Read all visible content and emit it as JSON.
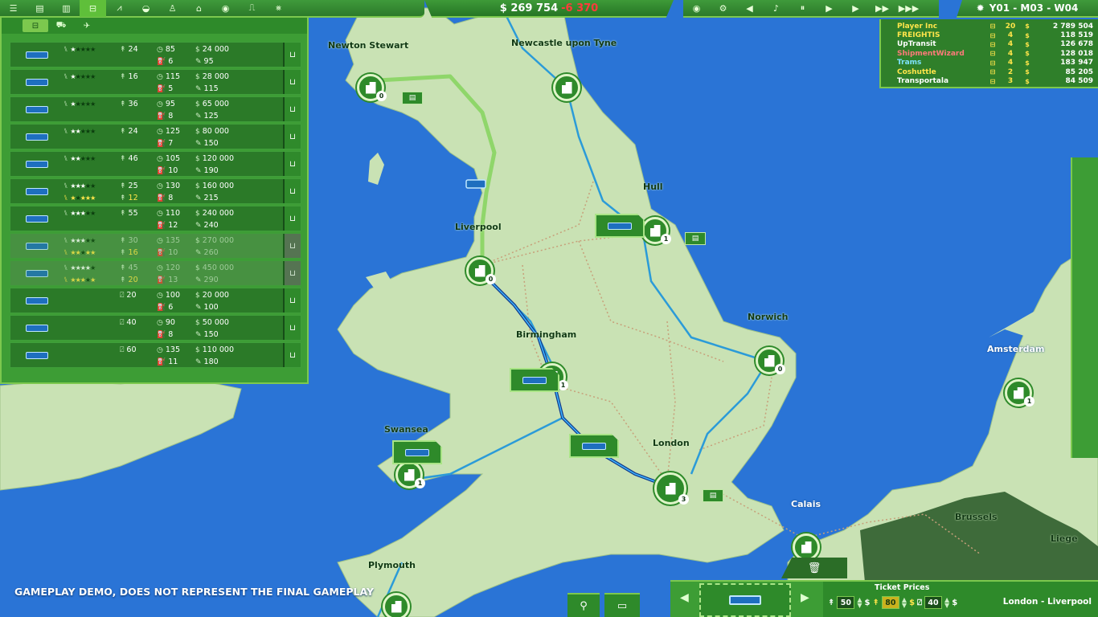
{
  "toolbar": {
    "left_icons": [
      "menu-icon",
      "finance-icon",
      "bank-icon",
      "bus-icon",
      "chart-icon",
      "helmet-icon",
      "person-icon",
      "building-icon",
      "gear-icon",
      "stats-icon",
      "graph-icon"
    ],
    "left_glyphs": [
      "☰",
      "▤",
      "▥",
      "⊟",
      "⩘",
      "◒",
      "♙",
      "⌂",
      "◉",
      "⎍",
      "⨳"
    ],
    "money": "$ 269 754",
    "money_delta": "-6 370",
    "media_glyphs": [
      "◉",
      "⚙",
      "◀",
      "♪",
      "⏸",
      "▶",
      "▶",
      "▶▶",
      "▶▶▶"
    ],
    "media_icons": [
      "eye-icon",
      "settings-icon",
      "volume-icon",
      "music-icon",
      "pause-icon",
      "play-icon",
      "speed1-icon",
      "speed2-icon",
      "speed3-icon"
    ],
    "date": "Y01 - M03 - W04"
  },
  "companies": [
    {
      "name": "Player Inc",
      "color": "#ffe54a",
      "count": "20",
      "value": "2 789 504"
    },
    {
      "name": "FREIGHTIS",
      "color": "#ffe54a",
      "count": "4",
      "value": "118 519"
    },
    {
      "name": "UpTransit",
      "color": "#ffffff",
      "count": "4",
      "value": "126 678"
    },
    {
      "name": "ShipmentWizard",
      "color": "#ff7a7a",
      "count": "4",
      "value": "128 018"
    },
    {
      "name": "Trams",
      "color": "#7fe3ff",
      "count": "4",
      "value": "183 947"
    },
    {
      "name": "Coshuttle",
      "color": "#ffe54a",
      "count": "2",
      "value": "85 205"
    },
    {
      "name": "Transportala",
      "color": "#ffffff",
      "count": "3",
      "value": "84 509"
    }
  ],
  "vehicle_tabs": [
    {
      "icon": "bus-icon",
      "glyph": "⊟",
      "active": true
    },
    {
      "icon": "truck-icon",
      "glyph": "⛟",
      "active": false
    },
    {
      "icon": "plane-icon",
      "glyph": "✈",
      "active": false
    }
  ],
  "vehicles": [
    {
      "stars": 1,
      "cap": "24",
      "speed": "85",
      "price": "24 000",
      "fuel": "6",
      "maint": "95",
      "type": "pax",
      "locked": false
    },
    {
      "stars": 1,
      "cap": "16",
      "speed": "115",
      "price": "28 000",
      "fuel": "5",
      "maint": "115",
      "type": "pax",
      "locked": false
    },
    {
      "stars": 1,
      "cap": "36",
      "speed": "95",
      "price": "65 000",
      "fuel": "8",
      "maint": "125",
      "type": "pax",
      "locked": false
    },
    {
      "stars": 2,
      "cap": "24",
      "speed": "125",
      "price": "80 000",
      "fuel": "7",
      "maint": "150",
      "type": "pax",
      "locked": false
    },
    {
      "stars": 2,
      "cap": "46",
      "speed": "105",
      "price": "120 000",
      "fuel": "10",
      "maint": "190",
      "type": "pax",
      "locked": false
    },
    {
      "stars": 3,
      "cap": "25",
      "speed": "130",
      "price": "160 000",
      "fuel": "8",
      "maint": "215",
      "type": "pax",
      "locked": false,
      "stars2": 1,
      "cap2": "12"
    },
    {
      "stars": 3,
      "cap": "55",
      "speed": "110",
      "price": "240 000",
      "fuel": "12",
      "maint": "240",
      "type": "pax",
      "locked": false
    },
    {
      "stars": 3,
      "cap": "30",
      "speed": "135",
      "price": "270 000",
      "fuel": "10",
      "maint": "260",
      "type": "pax",
      "locked": true,
      "stars2": 2,
      "cap2": "16"
    },
    {
      "stars": 4,
      "cap": "45",
      "speed": "120",
      "price": "450 000",
      "fuel": "13",
      "maint": "290",
      "type": "pax",
      "locked": true,
      "stars2": 3,
      "cap2": "20"
    },
    {
      "cargo": "20",
      "speed": "100",
      "price": "20 000",
      "fuel": "6",
      "maint": "100",
      "type": "cargo",
      "locked": false
    },
    {
      "cargo": "40",
      "speed": "90",
      "price": "50 000",
      "fuel": "8",
      "maint": "150",
      "type": "cargo",
      "locked": false
    },
    {
      "cargo": "60",
      "speed": "135",
      "price": "110 000",
      "fuel": "11",
      "maint": "180",
      "type": "cargo",
      "locked": false
    }
  ],
  "cities": [
    {
      "name": "Newton Stewart"
    },
    {
      "name": "Newcastle upon Tyne"
    },
    {
      "name": "Hull"
    },
    {
      "name": "Liverpool"
    },
    {
      "name": "Birmingham"
    },
    {
      "name": "Norwich"
    },
    {
      "name": "Amsterdam"
    },
    {
      "name": "Swansea"
    },
    {
      "name": "London"
    },
    {
      "name": "Calais"
    },
    {
      "name": "Brussels"
    },
    {
      "name": "Liege"
    },
    {
      "name": "Plymouth"
    }
  ],
  "station_counts": [
    "0",
    "1",
    "0",
    "1",
    "0",
    "1",
    "1",
    "3"
  ],
  "footer": {
    "demo_notice": "GAMEPLAY DEMO, DOES NOT REPRESENT THE FINAL GAMEPLAY",
    "ticket_title": "Ticket Prices",
    "ticket_pax": "50",
    "ticket_vip": "80",
    "ticket_cargo": "40",
    "currency_symbol": "$",
    "route": "London - Liverpool",
    "pin_glyph": "⚲",
    "folder_glyph": "▭",
    "trash_glyph": "🗑",
    "prev_glyph": "◀",
    "next_glyph": "▶"
  },
  "colors": {
    "accent": "#7cc84e",
    "panel": "#3d9d35",
    "sea": "#2a74d6",
    "land": "#c9e2b4",
    "route_active": "#8fd66a",
    "route_blue": "#2b9bd8",
    "debt": "#ff3b3b"
  }
}
